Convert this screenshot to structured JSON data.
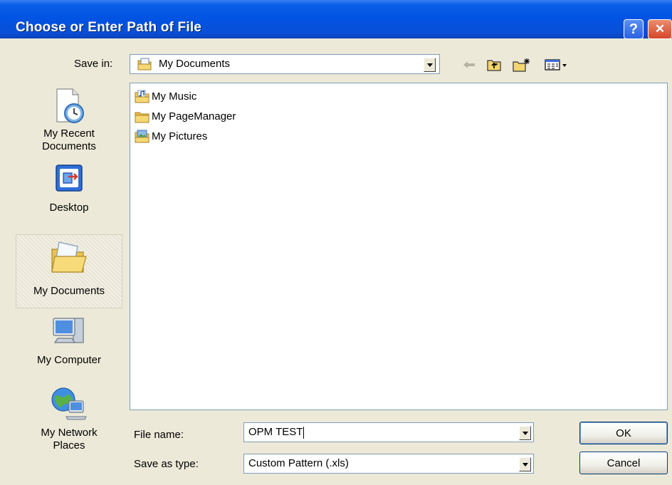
{
  "window": {
    "title": "Choose or Enter Path of File",
    "help_glyph": "?",
    "close_glyph": "✕"
  },
  "save_in": {
    "label": "Save in:",
    "value": "My Documents"
  },
  "toolbar": {
    "icons": [
      "back-arrow-icon",
      "up-folder-icon",
      "new-folder-icon",
      "views-menu-icon"
    ]
  },
  "places": [
    {
      "label_line1": "My Recent",
      "label_line2": "Documents",
      "icon": "recent-documents-icon"
    },
    {
      "label_line1": "Desktop",
      "label_line2": "",
      "icon": "desktop-icon"
    },
    {
      "label_line1": "My Documents",
      "label_line2": "",
      "icon": "my-documents-icon",
      "selected": true
    },
    {
      "label_line1": "My Computer",
      "label_line2": "",
      "icon": "my-computer-icon"
    },
    {
      "label_line1": "My Network",
      "label_line2": "Places",
      "icon": "network-places-icon"
    }
  ],
  "files": [
    {
      "name": "My Music",
      "icon": "music-folder-icon"
    },
    {
      "name": "My PageManager",
      "icon": "folder-icon"
    },
    {
      "name": "My Pictures",
      "icon": "pictures-folder-icon"
    }
  ],
  "file_name": {
    "label": "File name:",
    "value": "OPM TEST"
  },
  "save_as_type": {
    "label": "Save as type:",
    "value": "Custom Pattern (.xls)"
  },
  "buttons": {
    "ok": "OK",
    "cancel": "Cancel"
  },
  "colors": {
    "title_bar": "#0054e3",
    "dialog_bg": "#ece9d8",
    "input_border": "#7f9db9"
  }
}
